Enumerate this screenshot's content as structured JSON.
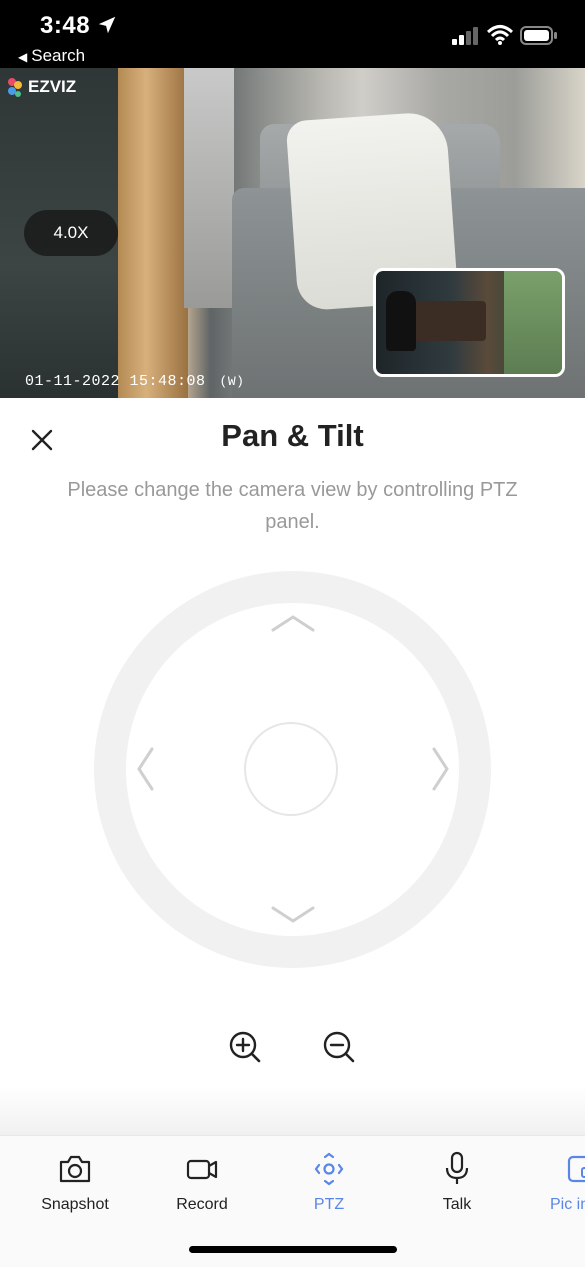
{
  "status_bar": {
    "time": "3:48",
    "back_label": "Search"
  },
  "video": {
    "brand": "EZVIZ",
    "zoom_level": "4.0X",
    "timestamp": "01-11-2022  15:48:08",
    "mode": "(W)"
  },
  "panel": {
    "title": "Pan & Tilt",
    "hint": "Please change the camera view by controlling PTZ panel."
  },
  "tabs": [
    {
      "label": "Snapshot",
      "icon": "camera-icon"
    },
    {
      "label": "Record",
      "icon": "video-camera-icon"
    },
    {
      "label": "PTZ",
      "icon": "ptz-icon",
      "active": true
    },
    {
      "label": "Talk",
      "icon": "microphone-icon"
    },
    {
      "label": "Pic in",
      "icon": "picture-in-picture-icon"
    }
  ],
  "colors": {
    "accent": "#5a86e6",
    "ring": "#f1f1f1",
    "text": "#222222",
    "hint": "#999999"
  }
}
